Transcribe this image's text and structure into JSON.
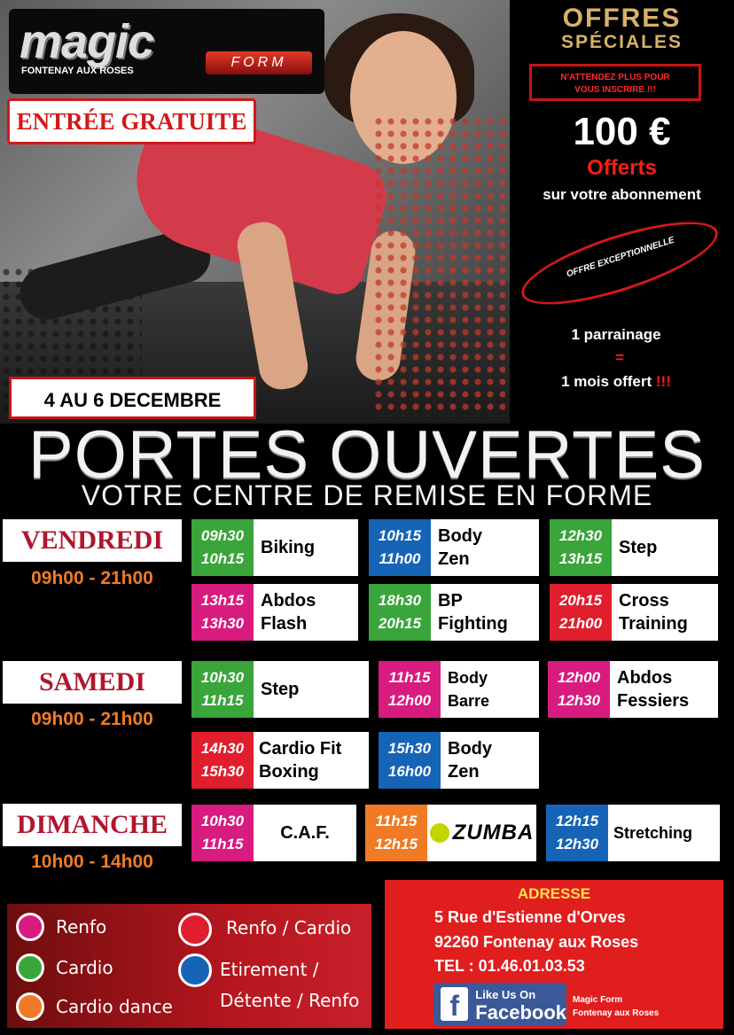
{
  "header": {
    "logo_word": "magic",
    "logo_form": "FORM",
    "logo_city": "FONTENAY AUX ROSES",
    "free_entry": "ENTRÉE GRATUITE",
    "dates": "4 AU 6 DECEMBRE"
  },
  "offers": {
    "title_line1": "OFFRES",
    "title_line2": "SPÉCIALES",
    "notice_line1": "N'ATTENDEZ PLUS POUR",
    "notice_line2": "VOUS INSCRIRE !!!",
    "amount": "100 €",
    "offered": "Offerts",
    "on_subscription": "sur votre abonnement",
    "exceptional": "OFFRE EXCEPTIONNELLE",
    "referral_line1": "1 parrainage",
    "referral_line2": "=",
    "referral_line3": "1 mois offert",
    "referral_exclaim": "!!!"
  },
  "banner": {
    "title": "PORTES OUVERTES",
    "subtitle": "VOTRE CENTRE DE REMISE EN FORME"
  },
  "schedule": {
    "friday": {
      "name": "VENDREDI",
      "hours": "09h00 - 21h00",
      "classes": [
        {
          "start": "09h30",
          "end": "10h15",
          "name1": "Biking",
          "name2": "",
          "color": "green"
        },
        {
          "start": "10h15",
          "end": "11h00",
          "name1": "Body",
          "name2": "Zen",
          "color": "blue"
        },
        {
          "start": "12h30",
          "end": "13h15",
          "name1": "Step",
          "name2": "",
          "color": "green"
        },
        {
          "start": "13h15",
          "end": "13h30",
          "name1": "Abdos",
          "name2": "Flash",
          "color": "pink"
        },
        {
          "start": "18h30",
          "end": "20h15",
          "name1": "BP",
          "name2": "Fighting",
          "color": "green"
        },
        {
          "start": "20h15",
          "end": "21h00",
          "name1": "Cross",
          "name2": "Training",
          "color": "red"
        }
      ]
    },
    "saturday": {
      "name": "SAMEDI",
      "hours": "09h00 - 21h00",
      "classes": [
        {
          "start": "10h30",
          "end": "11h15",
          "name1": "Step",
          "name2": "",
          "color": "green"
        },
        {
          "start": "11h15",
          "end": "12h00",
          "name1": "Body",
          "name2": "Barre",
          "color": "pink"
        },
        {
          "start": "12h00",
          "end": "12h30",
          "name1": "Abdos",
          "name2": "Fessiers",
          "color": "pink"
        },
        {
          "start": "14h30",
          "end": "15h30",
          "name1": "Cardio Fit",
          "name2": "Boxing",
          "color": "red"
        },
        {
          "start": "15h30",
          "end": "16h00",
          "name1": "Body",
          "name2": "Zen",
          "color": "blue"
        }
      ]
    },
    "sunday": {
      "name": "DIMANCHE",
      "hours": "10h00 - 14h00",
      "classes": [
        {
          "start": "10h30",
          "end": "11h15",
          "name1": "C.A.F.",
          "name2": "",
          "color": "pink"
        },
        {
          "start": "11h15",
          "end": "12h15",
          "name1": "ZUMBA",
          "name2": "",
          "color": "orange"
        },
        {
          "start": "12h15",
          "end": "12h30",
          "name1": "Stretching",
          "name2": "",
          "color": "blue"
        }
      ]
    }
  },
  "legend": {
    "renfo": "Renfo",
    "cardio": "Cardio",
    "cardio_dance": "Cardio dance",
    "renfo_cardio": "Renfo / Cardio",
    "etirement_line1": "Etirement /",
    "etirement_line2": "Détente / Renfo",
    "colors": {
      "pink": "#d81b7e",
      "green": "#3aa53a",
      "orange": "#f07a26",
      "red": "#e01e2d",
      "blue": "#1664b6"
    }
  },
  "address": {
    "heading": "ADRESSE",
    "street": "5 Rue d'Estienne d'Orves",
    "city": "92260 Fontenay aux Roses",
    "phone": "TEL : 01.46.01.03.53",
    "fb_like": "Like Us On",
    "fb_name": "Facebook",
    "fb_page_line1": "Magic Form",
    "fb_page_line2": "Fontenay aux Roses"
  }
}
